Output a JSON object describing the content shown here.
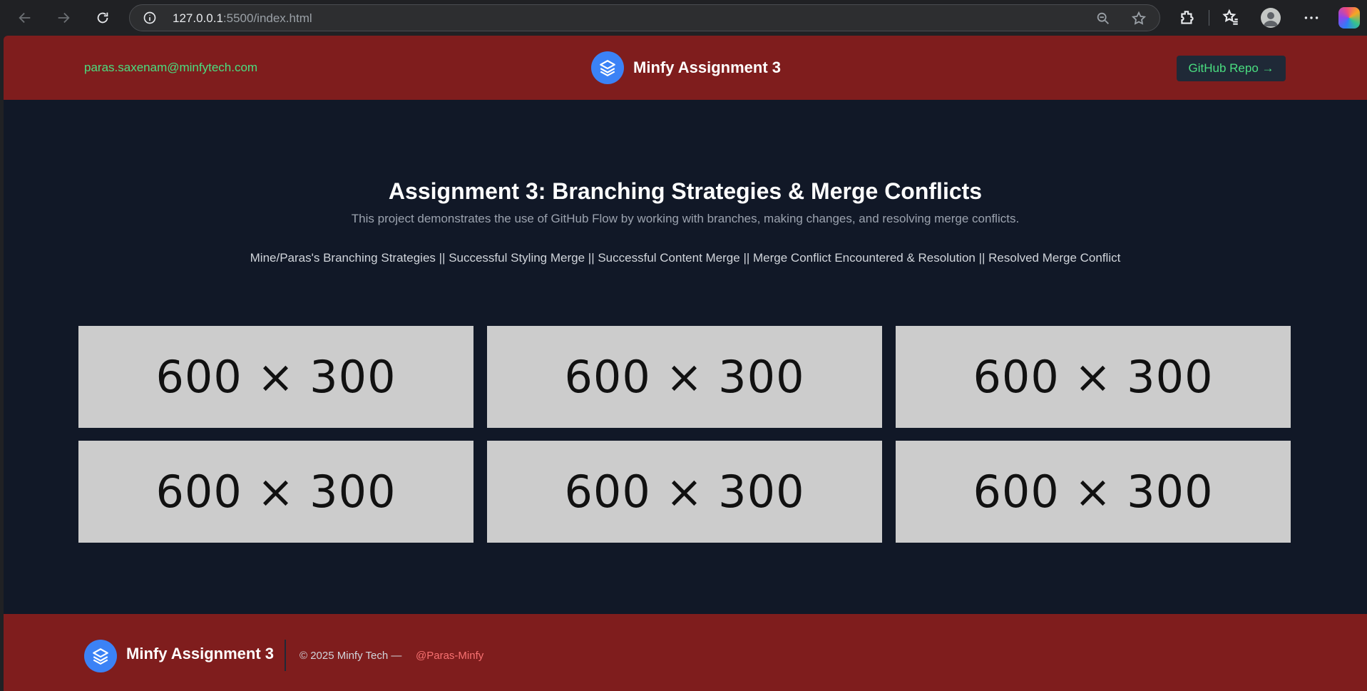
{
  "browser": {
    "url_host": "127.0.0.1",
    "url_rest": ":5500/index.html"
  },
  "header": {
    "email": "paras.saxenam@minfytech.com",
    "brand": "Minfy Assignment 3",
    "github_button": "GitHub Repo →"
  },
  "hero": {
    "title": "Assignment 3: Branching Strategies & Merge Conflicts",
    "description": "This project demonstrates the use of GitHub Flow by working with branches, making changes, and resolving merge conflicts.",
    "links": [
      "Mine/Paras's Branching Strategies",
      "Successful Styling Merge",
      "Successful Content Merge",
      "Merge Conflict Encountered & Resolution",
      "Resolved Merge Conflict"
    ],
    "separator": " || "
  },
  "gallery": {
    "placeholders": [
      "600 × 300",
      "600 × 300",
      "600 × 300",
      "600 × 300",
      "600 × 300",
      "600 × 300"
    ]
  },
  "footer": {
    "brand": "Minfy Assignment 3",
    "copyright": "© 2025 Minfy Tech —",
    "handle": "@Paras-Minfy"
  },
  "colors": {
    "header_bg": "#7f1d1d",
    "page_bg": "#111827",
    "accent_green": "#4ade80",
    "logo_blue": "#3b82f6",
    "handle_red": "#f87171"
  }
}
